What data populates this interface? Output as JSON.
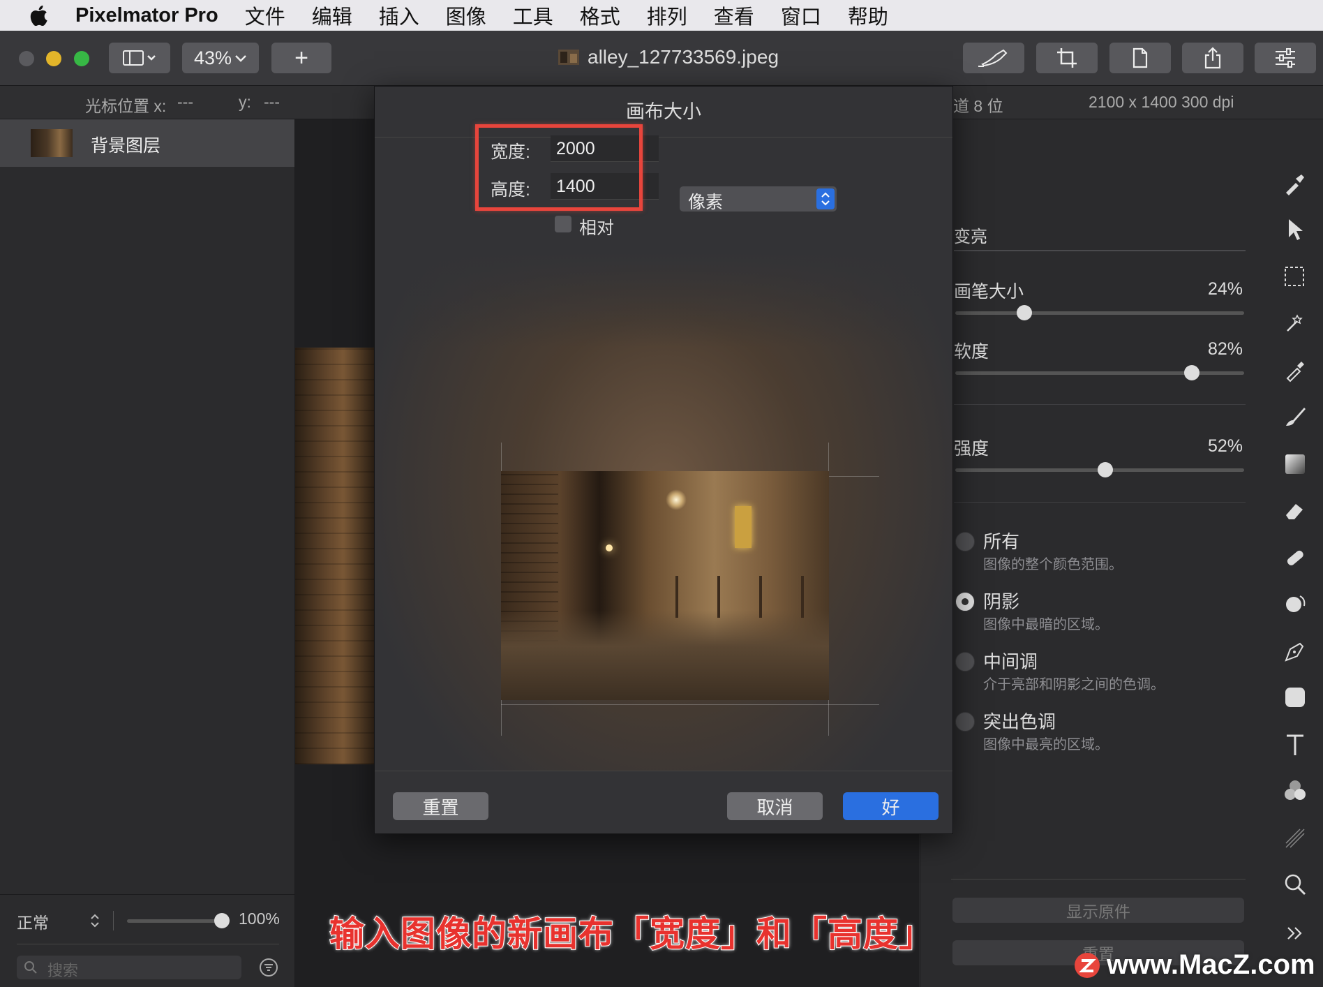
{
  "menubar": {
    "app_name": "Pixelmator Pro",
    "items": [
      "文件",
      "编辑",
      "插入",
      "图像",
      "工具",
      "格式",
      "排列",
      "查看",
      "窗口",
      "帮助"
    ]
  },
  "toolbar": {
    "zoom": "43%",
    "add_label": "+",
    "doc_title": "alley_127733569.jpeg"
  },
  "infobar": {
    "cursor_x_label": "光标位置 x:",
    "cursor_x": "---",
    "cursor_y_label": "y:",
    "cursor_y": "---",
    "channel_info": "道 8 位",
    "dims": "2100 x 1400 300 dpi"
  },
  "layers": {
    "layer_name": "背景图层",
    "blend_mode": "正常",
    "opacity": "100%",
    "opacity_value": 1.0,
    "search_placeholder": "搜索"
  },
  "adjust": {
    "title": "变亮",
    "sliders": [
      {
        "label": "画笔大小",
        "value": "24%",
        "level": 0.24
      },
      {
        "label": "软度",
        "value": "82%",
        "level": 0.82
      },
      {
        "label": "强度",
        "value": "52%",
        "level": 0.52
      }
    ],
    "options": [
      {
        "title": "所有",
        "desc": "图像的整个颜色范围。",
        "selected": false
      },
      {
        "title": "阴影",
        "desc": "图像中最暗的区域。",
        "selected": true
      },
      {
        "title": "中间调",
        "desc": "介于亮部和阴影之间的色调。",
        "selected": false
      },
      {
        "title": "突出色调",
        "desc": "图像中最亮的区域。",
        "selected": false
      }
    ],
    "show_original": "显示原件",
    "reset": "重置"
  },
  "dialog": {
    "title": "画布大小",
    "width_label": "宽度:",
    "width_value": "2000",
    "height_label": "高度:",
    "height_value": "1400",
    "unit": "像素",
    "relative_label": "相对",
    "reset": "重置",
    "cancel": "取消",
    "ok": "好"
  },
  "caption": "输入图像的新画布「宽度」和「高度」",
  "watermark": "www.MacZ.com",
  "colors": {
    "accent": "#2a6fe0",
    "highlight_box": "#e8453c"
  }
}
